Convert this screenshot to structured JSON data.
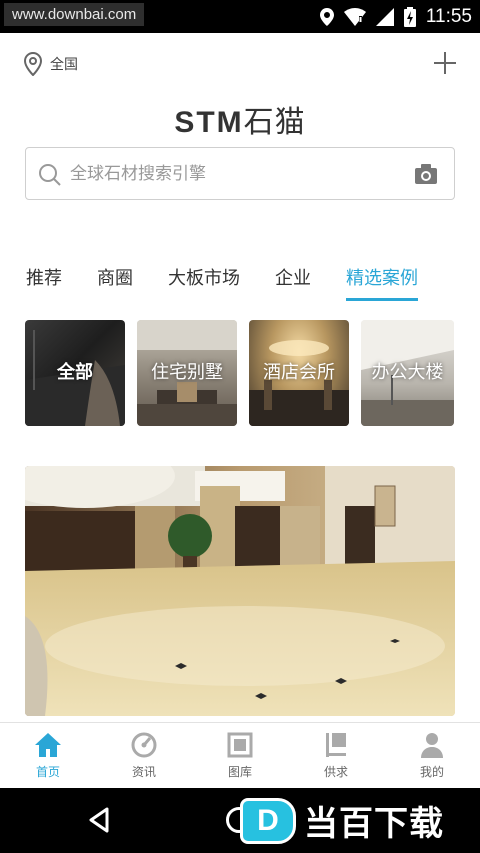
{
  "status_bar": {
    "url_watermark": "www.downbai.com",
    "time": "11:55",
    "icons": [
      "location-icon",
      "wifi-icon",
      "signal-icon",
      "battery-charging-icon"
    ]
  },
  "header": {
    "location": "全国",
    "logo_latin": "STM",
    "logo_cn": "石猫",
    "add_icon": "plus-icon"
  },
  "search": {
    "placeholder": "全球石材搜索引擎",
    "camera_icon": "camera-icon"
  },
  "tabs": [
    {
      "label": "推荐",
      "active": false
    },
    {
      "label": "商圈",
      "active": false
    },
    {
      "label": "大板市场",
      "active": false
    },
    {
      "label": "企业",
      "active": false
    },
    {
      "label": "精选案例",
      "active": true
    }
  ],
  "categories": [
    {
      "label": "全部"
    },
    {
      "label": "住宅别墅"
    },
    {
      "label": "酒店会所"
    },
    {
      "label": "办公大楼"
    }
  ],
  "bottom_nav": [
    {
      "label": "首页",
      "icon": "home-icon",
      "active": true
    },
    {
      "label": "资讯",
      "icon": "news-gauge-icon",
      "active": false
    },
    {
      "label": "图库",
      "icon": "gallery-icon",
      "active": false
    },
    {
      "label": "供求",
      "icon": "supply-demand-icon",
      "active": false
    },
    {
      "label": "我的",
      "icon": "profile-icon",
      "active": false
    }
  ],
  "site_logo": {
    "badge": "D",
    "text": "当百下载"
  },
  "colors": {
    "accent": "#2aa6d6",
    "text": "#333333",
    "muted": "#999999"
  }
}
